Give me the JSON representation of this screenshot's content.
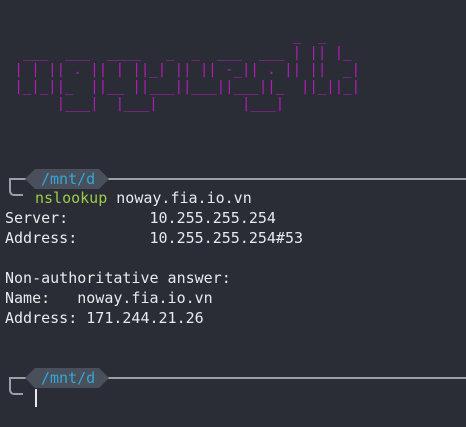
{
  "banner": {
    "art": "                                  _  _\n  ___  ___  ____   _  _  ___  ___ | || |_\n | | || . || | ||_| || || -_|| . || ||  _|\n |_|_||_  ||__ ||___||___||___||_  ||_||_|\n      |___|  |___|          |___|",
    "color": "#b21cb6"
  },
  "prompts": [
    {
      "cwd": "/mnt/d",
      "command_name": "nslookup",
      "command_args": " noway.fia.io.vn"
    },
    {
      "cwd": "/mnt/d"
    }
  ],
  "output": {
    "line1": "Server:         10.255.255.254",
    "line2": "Address:        10.255.255.254#53",
    "line3": "",
    "line4": "Non-authoritative answer:",
    "line5": "Name:   noway.fia.io.vn",
    "line6": "Address: 171.244.21.26"
  },
  "colors": {
    "background": "#2b2d36",
    "cwd": "#31a7d8",
    "command": "#9acb49",
    "text": "#e7e9ee"
  }
}
